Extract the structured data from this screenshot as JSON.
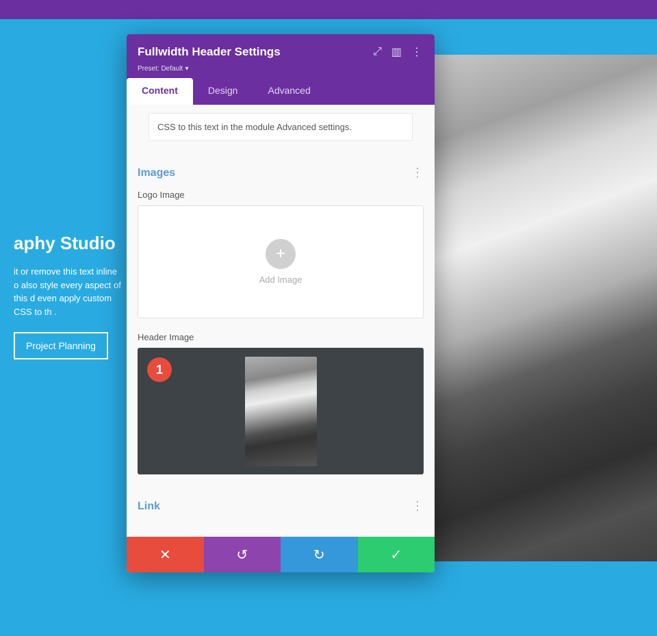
{
  "topBar": {},
  "pageBackground": {
    "title": "aphy Studio",
    "body": "it or remove this text inline o\nalso style every aspect of this \nd even apply custom CSS to th\n.",
    "button": "Project Planning"
  },
  "modal": {
    "title": "Fullwidth Header Settings",
    "preset": "Preset: Default",
    "presetArrow": "▾",
    "tabs": [
      "Content",
      "Design",
      "Advanced"
    ],
    "activeTab": "Content",
    "icons": {
      "expand": "⤢",
      "split": "▥",
      "menu": "⋮"
    },
    "textNote": "CSS to this text in the module Advanced settings.",
    "sections": {
      "images": {
        "title": "Images",
        "logoImage": {
          "label": "Logo Image",
          "addLabel": "Add Image"
        },
        "headerImage": {
          "label": "Header Image",
          "badge": "1"
        }
      },
      "link": {
        "title": "Link"
      }
    },
    "footer": {
      "cancel": "✕",
      "undo": "↺",
      "redo": "↻",
      "save": "✓"
    }
  }
}
